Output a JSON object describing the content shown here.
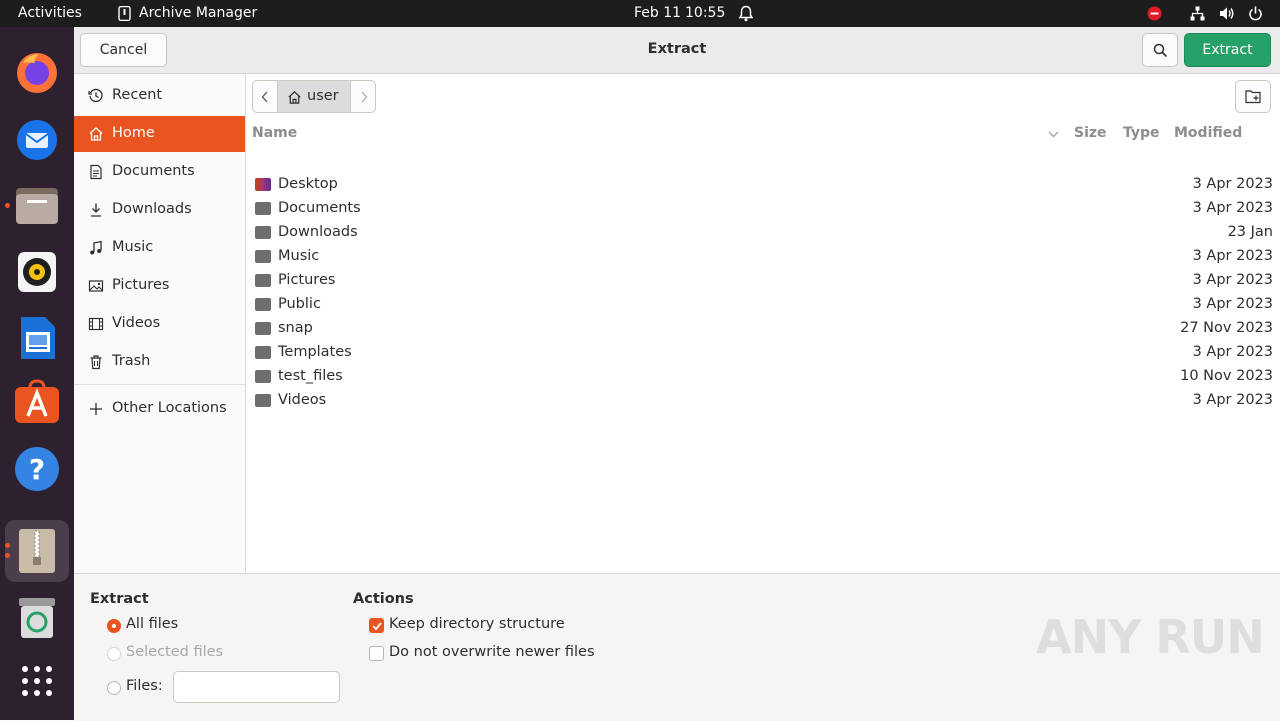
{
  "topbar": {
    "activities": "Activities",
    "app_name": "Archive Manager",
    "date": "Feb 11",
    "time": "10:55"
  },
  "dock": {
    "apps": [
      "firefox-icon",
      "thunderbird-icon",
      "files-icon",
      "rhythmbox-icon",
      "libreoffice-writer-icon",
      "app-center-icon",
      "help-icon",
      "archive-manager-icon",
      "trash-icon",
      "show-apps-icon"
    ]
  },
  "header": {
    "cancel_label": "Cancel",
    "title": "Extract",
    "extract_label": "Extract"
  },
  "sidebar": {
    "items": [
      {
        "label": "Recent",
        "icon": "clock-icon"
      },
      {
        "label": "Home",
        "icon": "home-icon"
      },
      {
        "label": "Documents",
        "icon": "document-icon"
      },
      {
        "label": "Downloads",
        "icon": "download-icon"
      },
      {
        "label": "Music",
        "icon": "music-icon"
      },
      {
        "label": "Pictures",
        "icon": "picture-icon"
      },
      {
        "label": "Videos",
        "icon": "video-icon"
      },
      {
        "label": "Trash",
        "icon": "trash-icon"
      }
    ],
    "other_locations": "Other Locations"
  },
  "pathbar": {
    "current": "user"
  },
  "columns": {
    "name": "Name",
    "size": "Size",
    "type": "Type",
    "modified": "Modified"
  },
  "files": [
    {
      "name": "Desktop",
      "modified": "3 Apr 2023"
    },
    {
      "name": "Documents",
      "modified": "3 Apr 2023"
    },
    {
      "name": "Downloads",
      "modified": "23 Jan"
    },
    {
      "name": "Music",
      "modified": "3 Apr 2023"
    },
    {
      "name": "Pictures",
      "modified": "3 Apr 2023"
    },
    {
      "name": "Public",
      "modified": "3 Apr 2023"
    },
    {
      "name": "snap",
      "modified": "27 Nov 2023"
    },
    {
      "name": "Templates",
      "modified": "3 Apr 2023"
    },
    {
      "name": "test_files",
      "modified": "10 Nov 2023"
    },
    {
      "name": "Videos",
      "modified": "3 Apr 2023"
    }
  ],
  "extract_options": {
    "section_title": "Extract",
    "all_files": "All files",
    "selected_files": "Selected files",
    "files_label": "Files:",
    "files_value": ""
  },
  "actions": {
    "section_title": "Actions",
    "keep_structure": "Keep directory structure",
    "keep_structure_checked": true,
    "no_overwrite": "Do not overwrite newer files",
    "no_overwrite_checked": false
  },
  "watermark": "ANY RUN",
  "colors": {
    "accent": "#e95420",
    "extract_button": "#26a269",
    "topbar": "#1d1d1d",
    "dock": "#2d2130"
  }
}
